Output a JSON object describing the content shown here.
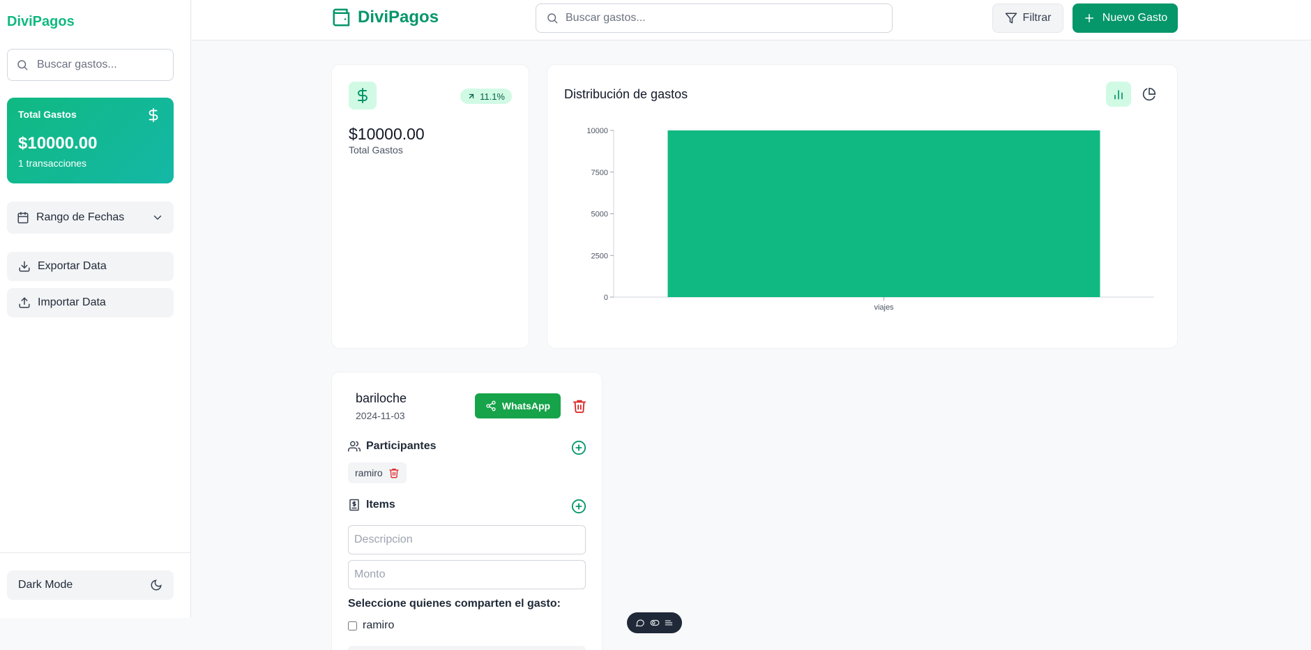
{
  "sidebar": {
    "brand": "DiviPagos",
    "search_placeholder": "Buscar gastos...",
    "total_card": {
      "label": "Total Gastos",
      "amount": "$10000.00",
      "transactions": "1 transacciones"
    },
    "date_range_label": "Rango de Fechas",
    "export_label": "Exportar Data",
    "import_label": "Importar Data",
    "dark_mode_label": "Dark Mode"
  },
  "header": {
    "brand": "DiviPagos",
    "search_placeholder": "Buscar gastos...",
    "filter_label": "Filtrar",
    "new_expense_label": "Nuevo Gasto"
  },
  "stat_card": {
    "badge": "11.1%",
    "amount": "$10000.00",
    "label": "Total Gastos"
  },
  "chart_card": {
    "title": "Distribución de gastos"
  },
  "chart_data": {
    "type": "bar",
    "categories": [
      "viajes"
    ],
    "values": [
      10000
    ],
    "ylim": [
      0,
      10000
    ],
    "yticks": [
      "0",
      "2500",
      "5000",
      "7500",
      "10000"
    ],
    "grid": false,
    "color": "#10b981"
  },
  "expense": {
    "name": "bariloche",
    "date": "2024-11-03",
    "whatsapp_label": "WhatsApp",
    "participants_title": "Participantes",
    "participants": [
      "ramiro"
    ],
    "items_title": "Items",
    "description_placeholder": "Descripcion",
    "amount_placeholder": "Monto",
    "share_label": "Seleccione quienes comparten el gasto:",
    "share_options": [
      "ramiro"
    ]
  },
  "colors": {
    "brand": "#059669",
    "accent": "#10b981",
    "danger": "#dc2626",
    "whatsapp": "#16a34a"
  }
}
